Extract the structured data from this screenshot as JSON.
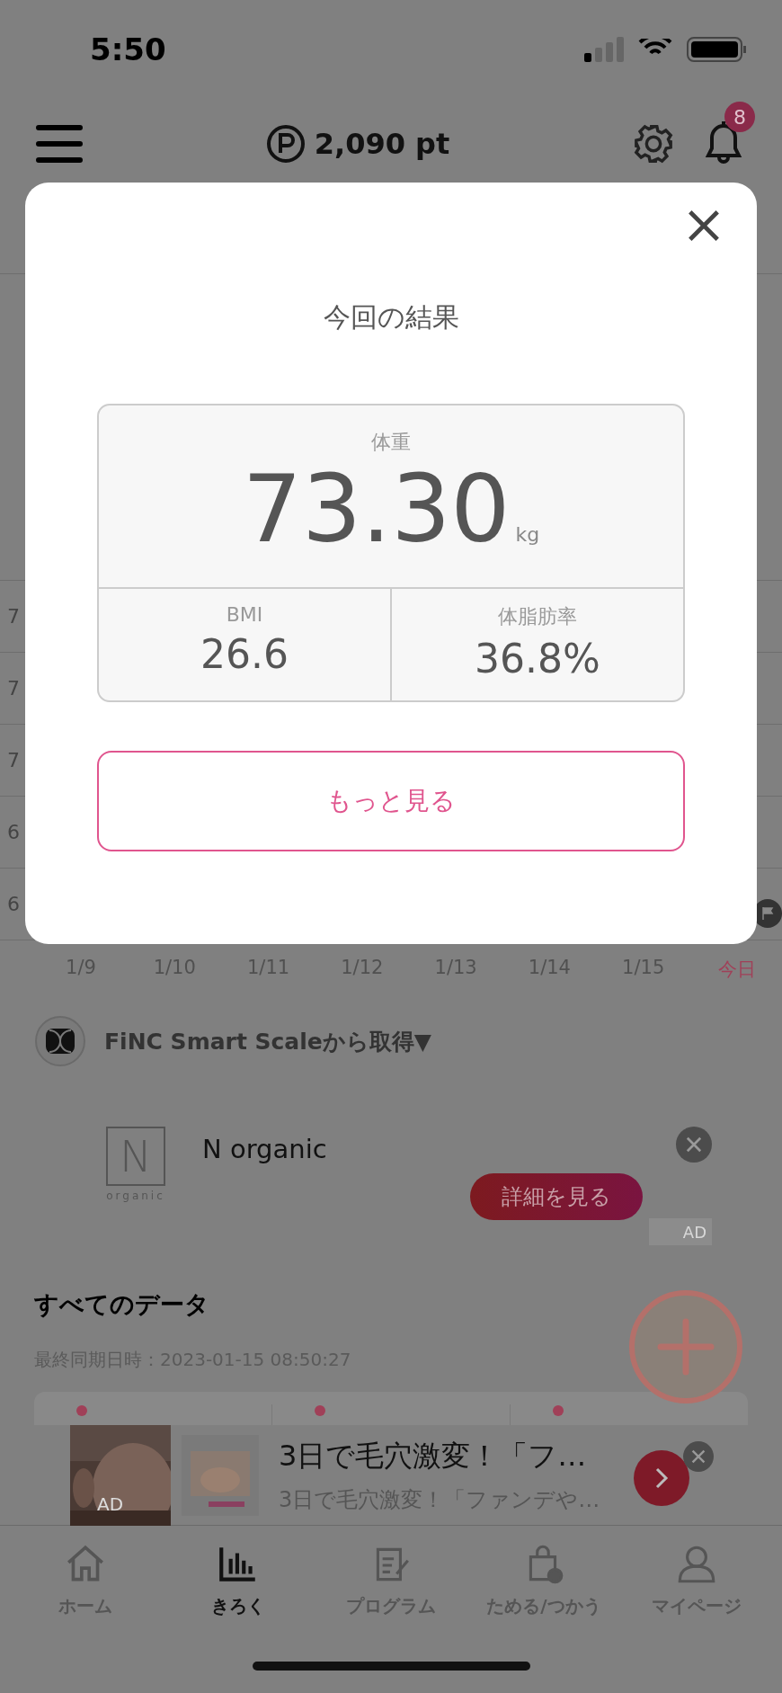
{
  "status_bar": {
    "time": "5:50"
  },
  "header": {
    "points": "2,090 pt",
    "badge": "8"
  },
  "chart": {
    "y_labels": [
      "7",
      "7",
      "7",
      "6",
      "6"
    ],
    "x_labels": [
      {
        "label": "1/9",
        "today": false
      },
      {
        "label": "1/10",
        "today": false
      },
      {
        "label": "1/11",
        "today": false
      },
      {
        "label": "1/12",
        "today": false
      },
      {
        "label": "1/13",
        "today": false
      },
      {
        "label": "1/14",
        "today": false
      },
      {
        "label": "1/15",
        "today": false
      },
      {
        "label": "今日",
        "today": true
      }
    ]
  },
  "source": {
    "label": "FiNC Smart Scaleから取得▼"
  },
  "ad": {
    "brand": "N organic",
    "logo_letter": "N",
    "logo_word": "organic",
    "button": "詳細を見る",
    "badge": "AD"
  },
  "all_data": {
    "title": "すべてのデータ",
    "synced": "最終同期日時：2023-01-15 08:50:27"
  },
  "banner": {
    "title": "3日で毛穴激変！「フ…",
    "subtitle": "3日で毛穴激変！「ファンデや…",
    "badge": "AD"
  },
  "tabs": [
    {
      "label": "ホーム",
      "selected": false
    },
    {
      "label": "きろく",
      "selected": true
    },
    {
      "label": "プログラム",
      "selected": false
    },
    {
      "label": "ためる/つかう",
      "selected": false
    },
    {
      "label": "マイページ",
      "selected": false
    }
  ],
  "modal": {
    "title": "今回の結果",
    "weight": {
      "label": "体重",
      "value": "73.30",
      "unit": "kg"
    },
    "stats": [
      {
        "label": "BMI",
        "value": "26.6"
      },
      {
        "label": "体脂肪率",
        "value": "36.8%"
      }
    ],
    "button": "もっと見る"
  }
}
